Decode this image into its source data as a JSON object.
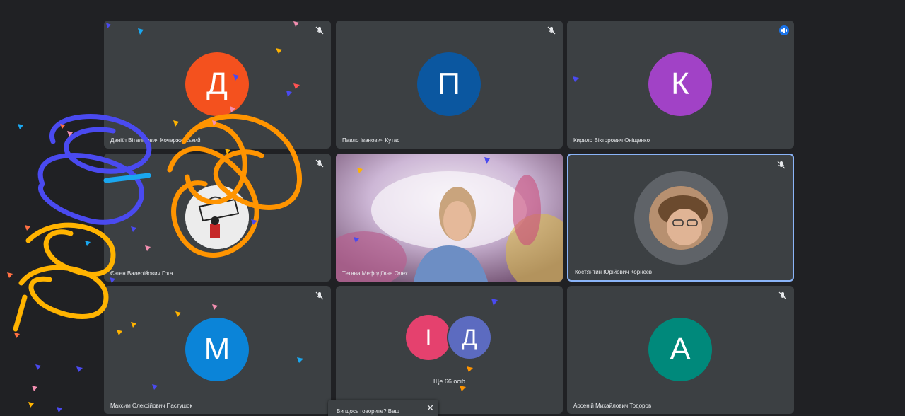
{
  "colors": {
    "background": "#202124",
    "tile": "#3c4043",
    "active_border": "#8ab4f8",
    "speaking_badge": "#1a73e8"
  },
  "tiles": [
    {
      "name": "Даніїл Віталійович Кочержинський",
      "initial": "Д",
      "avatar_color": "#f4511e",
      "mic": "muted-icon"
    },
    {
      "name": "Павло Іванович Кутас",
      "initial": "П",
      "avatar_color": "#0b57a0",
      "mic": "muted-icon"
    },
    {
      "name": "Кирило Вікторович Оніщенко",
      "initial": "К",
      "avatar_color": "#a142c6",
      "mic": "speaking-icon"
    },
    {
      "name": "Євген Валерійович Гога",
      "initial": "",
      "avatar_color": "#e6e6e6",
      "mic": "muted-icon"
    },
    {
      "name": "Тетяна Мефодіївна Олех",
      "initial": "",
      "avatar_color": "",
      "mic": "none"
    },
    {
      "name": "Костянтин Юрійович Корнєєв",
      "initial": "",
      "avatar_color": "#5f6368",
      "mic": "muted-icon"
    },
    {
      "name": "Максим Олексійович Пастушок",
      "initial": "М",
      "avatar_color": "#0b84d8",
      "mic": "muted-icon"
    },
    {
      "name": "",
      "initial": "",
      "avatar_color": "",
      "mic": "none"
    },
    {
      "name": "Арсеній Михайлович Тодоров",
      "initial": "А",
      "avatar_color": "#00897b",
      "mic": "muted-icon"
    }
  ],
  "more_tile": {
    "initials": [
      "І",
      "Д"
    ],
    "initial_colors": [
      "#e5416e",
      "#5c6bc0"
    ],
    "label": "Ще 66 осіб"
  },
  "toast": {
    "text": "Ви щось говорите? Ваш",
    "close": "✕"
  }
}
